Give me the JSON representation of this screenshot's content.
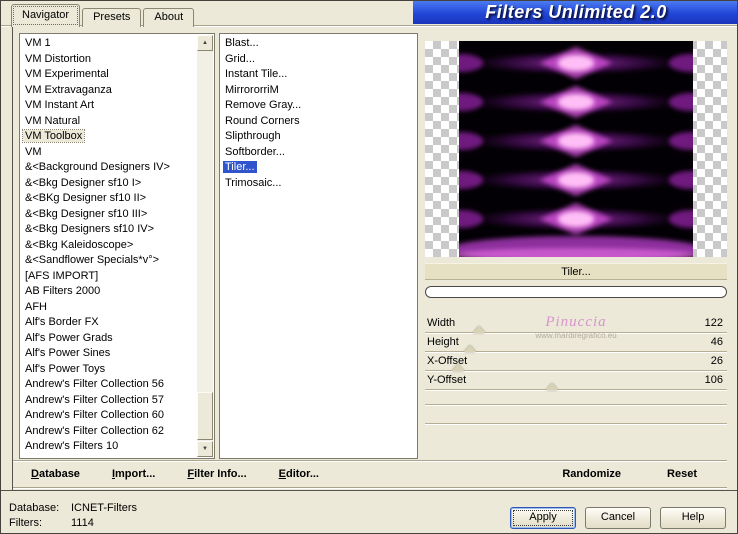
{
  "title": {
    "banner": "Filters Unlimited 2.0"
  },
  "tabs": [
    {
      "label": "Navigator",
      "selected": true
    },
    {
      "label": "Presets"
    },
    {
      "label": "About"
    }
  ],
  "icons": {
    "scroll_up": "▲",
    "scroll_down": "▼"
  },
  "category_list": {
    "items": [
      {
        "label": "VM 1"
      },
      {
        "label": "VM Distortion"
      },
      {
        "label": "VM Experimental"
      },
      {
        "label": "VM Extravaganza"
      },
      {
        "label": "VM Instant Art"
      },
      {
        "label": "VM Natural"
      },
      {
        "label": "VM Toolbox",
        "selected": true
      },
      {
        "label": "VM"
      },
      {
        "label": "&<Background Designers IV>"
      },
      {
        "label": "&<Bkg Designer sf10 I>"
      },
      {
        "label": "&<BKg Designer sf10 II>"
      },
      {
        "label": "&<Bkg Designer sf10 III>"
      },
      {
        "label": "&<Bkg Designers sf10 IV>"
      },
      {
        "label": "&<Bkg Kaleidoscope>"
      },
      {
        "label": "&<Sandflower Specials*v°>"
      },
      {
        "label": "[AFS IMPORT]"
      },
      {
        "label": "AB Filters 2000"
      },
      {
        "label": "AFH"
      },
      {
        "label": "Alf's Border FX"
      },
      {
        "label": "Alf's Power Grads"
      },
      {
        "label": "Alf's Power Sines"
      },
      {
        "label": "Alf's Power Toys"
      },
      {
        "label": "Andrew's Filter Collection 56"
      },
      {
        "label": "Andrew's Filter Collection 57"
      },
      {
        "label": "Andrew's Filter Collection 60"
      },
      {
        "label": "Andrew's Filter Collection 62"
      },
      {
        "label": "Andrew's Filters 10"
      }
    ]
  },
  "filter_list": {
    "items": [
      {
        "label": "Blast..."
      },
      {
        "label": "Grid..."
      },
      {
        "label": "Instant Tile..."
      },
      {
        "label": "MirrororriM"
      },
      {
        "label": "Remove Gray..."
      },
      {
        "label": "Round Corners"
      },
      {
        "label": "Slipthrough"
      },
      {
        "label": "Softborder..."
      },
      {
        "label": "Tiler...",
        "selected": true
      },
      {
        "label": "Trimosaic..."
      }
    ]
  },
  "preview": {
    "caption": "Tiler..."
  },
  "params": {
    "rows": [
      {
        "label": "Width",
        "value": "122",
        "thumb": 18
      },
      {
        "label": "Height",
        "value": "46",
        "thumb": 15
      },
      {
        "label": "X-Offset",
        "value": "26",
        "thumb": 11
      },
      {
        "label": "Y-Offset",
        "value": "106",
        "thumb": 42
      }
    ]
  },
  "watermark": {
    "line1": "Pinuccia",
    "line2": "www.mardiregrafico.eu"
  },
  "commands": [
    {
      "label": "Database",
      "key": "D"
    },
    {
      "label": "Import...",
      "key": "I"
    },
    {
      "label": "Filter Info...",
      "key": "F"
    },
    {
      "label": "Editor...",
      "key": "E"
    }
  ],
  "actions": [
    {
      "label": "Randomize"
    },
    {
      "label": "Reset"
    }
  ],
  "status": {
    "database_label": "Database:",
    "database_value": "ICNET-Filters",
    "filters_label": "Filters:",
    "filters_value": "1114"
  },
  "buttons": [
    {
      "label": "Apply",
      "default": true
    },
    {
      "label": "Cancel"
    },
    {
      "label": "Help"
    }
  ],
  "colors": {
    "dialog_bg": "#ece9d8",
    "banner_blue": "#2246d8",
    "selection_blue": "#2f54cc",
    "preview_magenta": "#cf4fd4"
  }
}
